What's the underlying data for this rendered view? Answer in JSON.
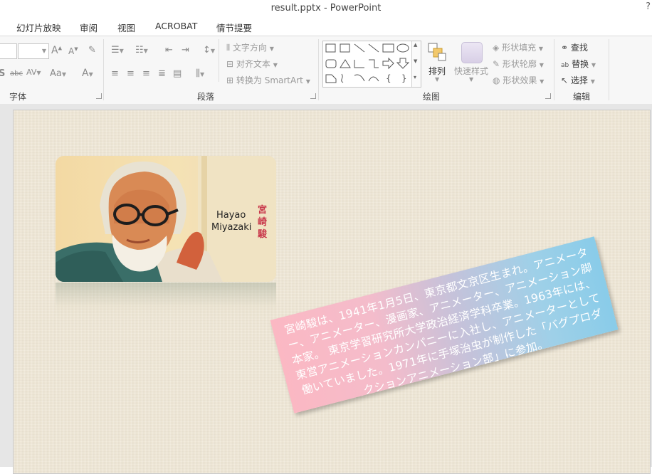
{
  "window": {
    "title": "result.pptx - PowerPoint",
    "help": "?"
  },
  "tabs": [
    "幻灯片放映",
    "审阅",
    "视图",
    "ACROBAT",
    "情节提要"
  ],
  "ribbon": {
    "groups": {
      "font": "字体",
      "paragraph": "段落",
      "drawing": "绘图",
      "editing": "编辑"
    },
    "paragraph": {
      "text_direction": "文字方向",
      "align_text": "对齐文本",
      "convert_smartart": "转换为 SmartArt"
    },
    "drawing": {
      "arrange": "排列",
      "quick_styles": "快速样式",
      "shape_fill": "形状填充",
      "shape_outline": "形状轮廓",
      "shape_effects": "形状效果"
    },
    "editing": {
      "find": "查找",
      "replace": "替换",
      "select": "选择"
    },
    "font_glyphs": {
      "grow": "A",
      "shrink": "A",
      "abc": "abc",
      "aa": "Aa",
      "fontcolor": "A"
    }
  },
  "slide": {
    "photo_name_en_line1": "Hayao",
    "photo_name_en_line2": "Miyazaki",
    "photo_name_jp_1": "宮",
    "photo_name_jp_2": "崎",
    "photo_name_jp_3": "駿",
    "caption": "宮崎駿は、1941年1月5日、東京都文京区生まれ。アニメーター、アニメーター、漫画家、アニメーター、アニメーション脚本家。 東京学習研究所大学政治経済学科卒業。1963年には、東営アニメーションカンパニーに入社し、アニメーターとして働いていました。1971年に手塚治虫が制作した「バグプロダクションアニメーション部」に参加。"
  },
  "colors": {
    "caption_gradient_start": "#fbb8c3",
    "caption_gradient_end": "#89cce9",
    "jp_name_color": "#c8374a",
    "slide_bg": "#efe7d6"
  }
}
